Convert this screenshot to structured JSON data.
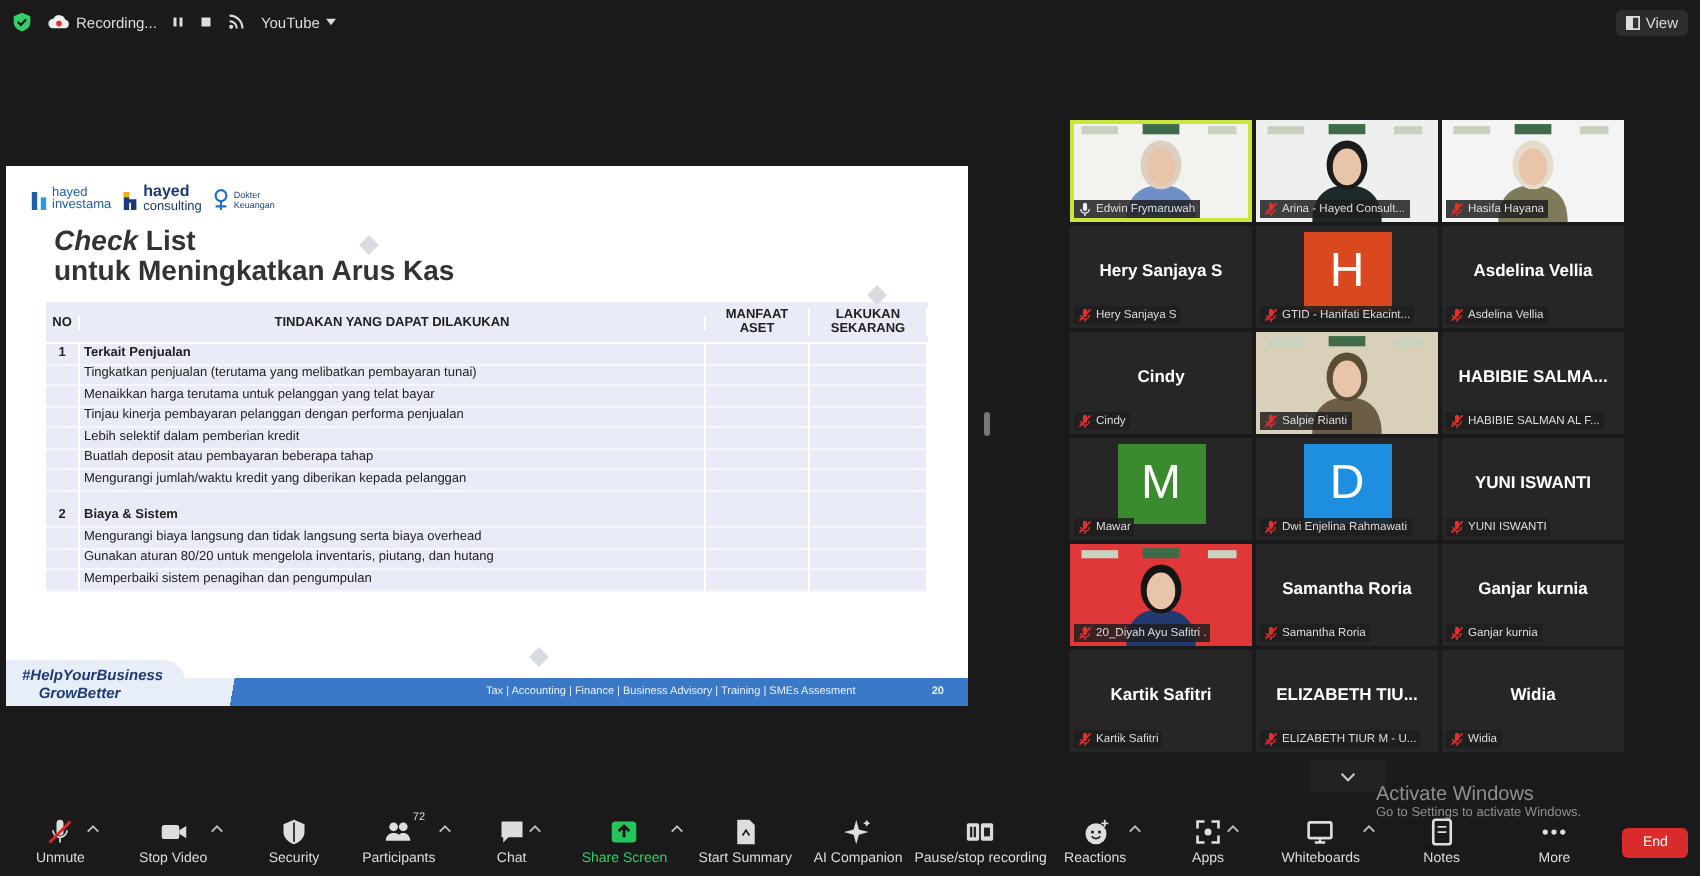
{
  "top_bar": {
    "recording_label": "Recording...",
    "stream_label": "YouTube",
    "view_button": "View"
  },
  "slide": {
    "logos": [
      {
        "kind": "investama",
        "line1": "hayed",
        "line2": "investama"
      },
      {
        "kind": "consulting",
        "line1": "hayed",
        "line2": "consulting"
      },
      {
        "kind": "dokter",
        "line1": "Dokter",
        "line2": "Keuangan"
      }
    ],
    "title": "*Check* List",
    "subtitle": "untuk Meningkatkan Arus Kas",
    "columns": [
      "NO",
      "TINDAKAN YANG DAPAT DILAKUKAN",
      "MANFAAT ASET",
      "LAKUKAN SEKARANG"
    ],
    "sections": [
      {
        "number": "1",
        "title": "Terkait Penjualan",
        "items": [
          "Tingkatkan penjualan (terutama yang melibatkan pembayaran tunai)",
          "Menaikkan harga terutama untuk pelanggan yang telat bayar",
          "Tinjau kinerja pembayaran pelanggan dengan performa penjualan",
          "Lebih selektif dalam pemberian kredit",
          "Buatlah deposit atau pembayaran beberapa tahap",
          "Mengurangi jumlah/waktu kredit yang diberikan kepada pelanggan"
        ]
      },
      {
        "number": "2",
        "title": "Biaya & Sistem",
        "items": [
          "Mengurangi biaya langsung dan tidak langsung serta biaya overhead",
          "Gunakan aturan 80/20 untuk mengelola inventaris, piutang, dan hutang",
          "Memperbaiki sistem penagihan dan pengumpulan"
        ]
      }
    ],
    "hashtag_lines": [
      "#HelpYourBusiness",
      "GrowBetter"
    ],
    "services": "Tax | Accounting | Finance | Business Advisory | Training | SMEs Assesment",
    "page": "20"
  },
  "tiles": [
    {
      "kind": "video",
      "label": "Edwin Frymaruwah",
      "muted": false,
      "active": true
    },
    {
      "kind": "video",
      "label": "Arina - Hayed Consult...",
      "muted": true,
      "active": false
    },
    {
      "kind": "video",
      "label": "Hasifa Hayana",
      "muted": true,
      "active": false
    },
    {
      "kind": "name",
      "name": "Hery Sanjaya S",
      "label": "Hery Sanjaya S",
      "muted": true,
      "active": false
    },
    {
      "kind": "avatar",
      "letter": "H",
      "color": "#d9481e",
      "label": "GTID - Hanifati Ekacint...",
      "muted": true,
      "active": false
    },
    {
      "kind": "name",
      "name": "Asdelina Vellia",
      "label": "Asdelina Vellia",
      "muted": true,
      "active": false
    },
    {
      "kind": "name",
      "name": "Cindy",
      "label": "Cindy",
      "muted": true,
      "active": false
    },
    {
      "kind": "video",
      "label": "Salpie Rianti",
      "muted": true,
      "active": false
    },
    {
      "kind": "name",
      "name": "HABIBIE  SALMA...",
      "label": "HABIBIE SALMAN AL F...",
      "muted": true,
      "active": false
    },
    {
      "kind": "avatar",
      "letter": "M",
      "color": "#3a8a2e",
      "label": "Mawar",
      "muted": true,
      "active": false
    },
    {
      "kind": "avatar",
      "letter": "D",
      "color": "#1e8fe0",
      "label": "Dwi Enjelina Rahmawati",
      "muted": true,
      "active": false
    },
    {
      "kind": "name",
      "name": "YUNI ISWANTI",
      "label": "YUNI ISWANTI",
      "muted": true,
      "active": false
    },
    {
      "kind": "video",
      "label": "20_Diyah Ayu Safitri .",
      "muted": true,
      "active": false
    },
    {
      "kind": "name",
      "name": "Samantha Roria",
      "label": "Samantha Roria",
      "muted": true,
      "active": false
    },
    {
      "kind": "name",
      "name": "Ganjar kurnia",
      "label": "Ganjar kurnia",
      "muted": true,
      "active": false
    },
    {
      "kind": "name",
      "name": "Kartik Safitri",
      "label": "Kartik Safitri",
      "muted": true,
      "active": false
    },
    {
      "kind": "name",
      "name": "ELIZABETH  TIU...",
      "label": "ELIZABETH TIUR M - U...",
      "muted": true,
      "active": false
    },
    {
      "kind": "name",
      "name": "Widia",
      "label": "Widia",
      "muted": true,
      "active": false
    }
  ],
  "toolbar": [
    {
      "kind": "mic-off",
      "label": "Unmute",
      "caret": true
    },
    {
      "kind": "video",
      "label": "Stop Video",
      "caret": true
    },
    {
      "kind": "shield",
      "label": "Security",
      "caret": false
    },
    {
      "kind": "people",
      "label": "Participants",
      "count": "72",
      "caret": true
    },
    {
      "kind": "chat",
      "label": "Chat",
      "caret": true
    },
    {
      "kind": "share",
      "label": "Share Screen",
      "caret": true
    },
    {
      "kind": "summary",
      "label": "Start Summary",
      "caret": false
    },
    {
      "kind": "sparkle",
      "label": "AI Companion",
      "caret": false
    },
    {
      "kind": "pause-stop",
      "label": "Pause/stop recording",
      "caret": false
    },
    {
      "kind": "reaction",
      "label": "Reactions",
      "caret": true
    },
    {
      "kind": "apps",
      "label": "Apps",
      "caret": true
    },
    {
      "kind": "whiteboard",
      "label": "Whiteboards",
      "caret": true
    },
    {
      "kind": "notes",
      "label": "Notes",
      "caret": false
    },
    {
      "kind": "more",
      "label": "More",
      "caret": false
    }
  ],
  "end_button": "End",
  "system_notice": {
    "title": "Activate Windows",
    "text": "Go to Settings to activate Windows."
  }
}
